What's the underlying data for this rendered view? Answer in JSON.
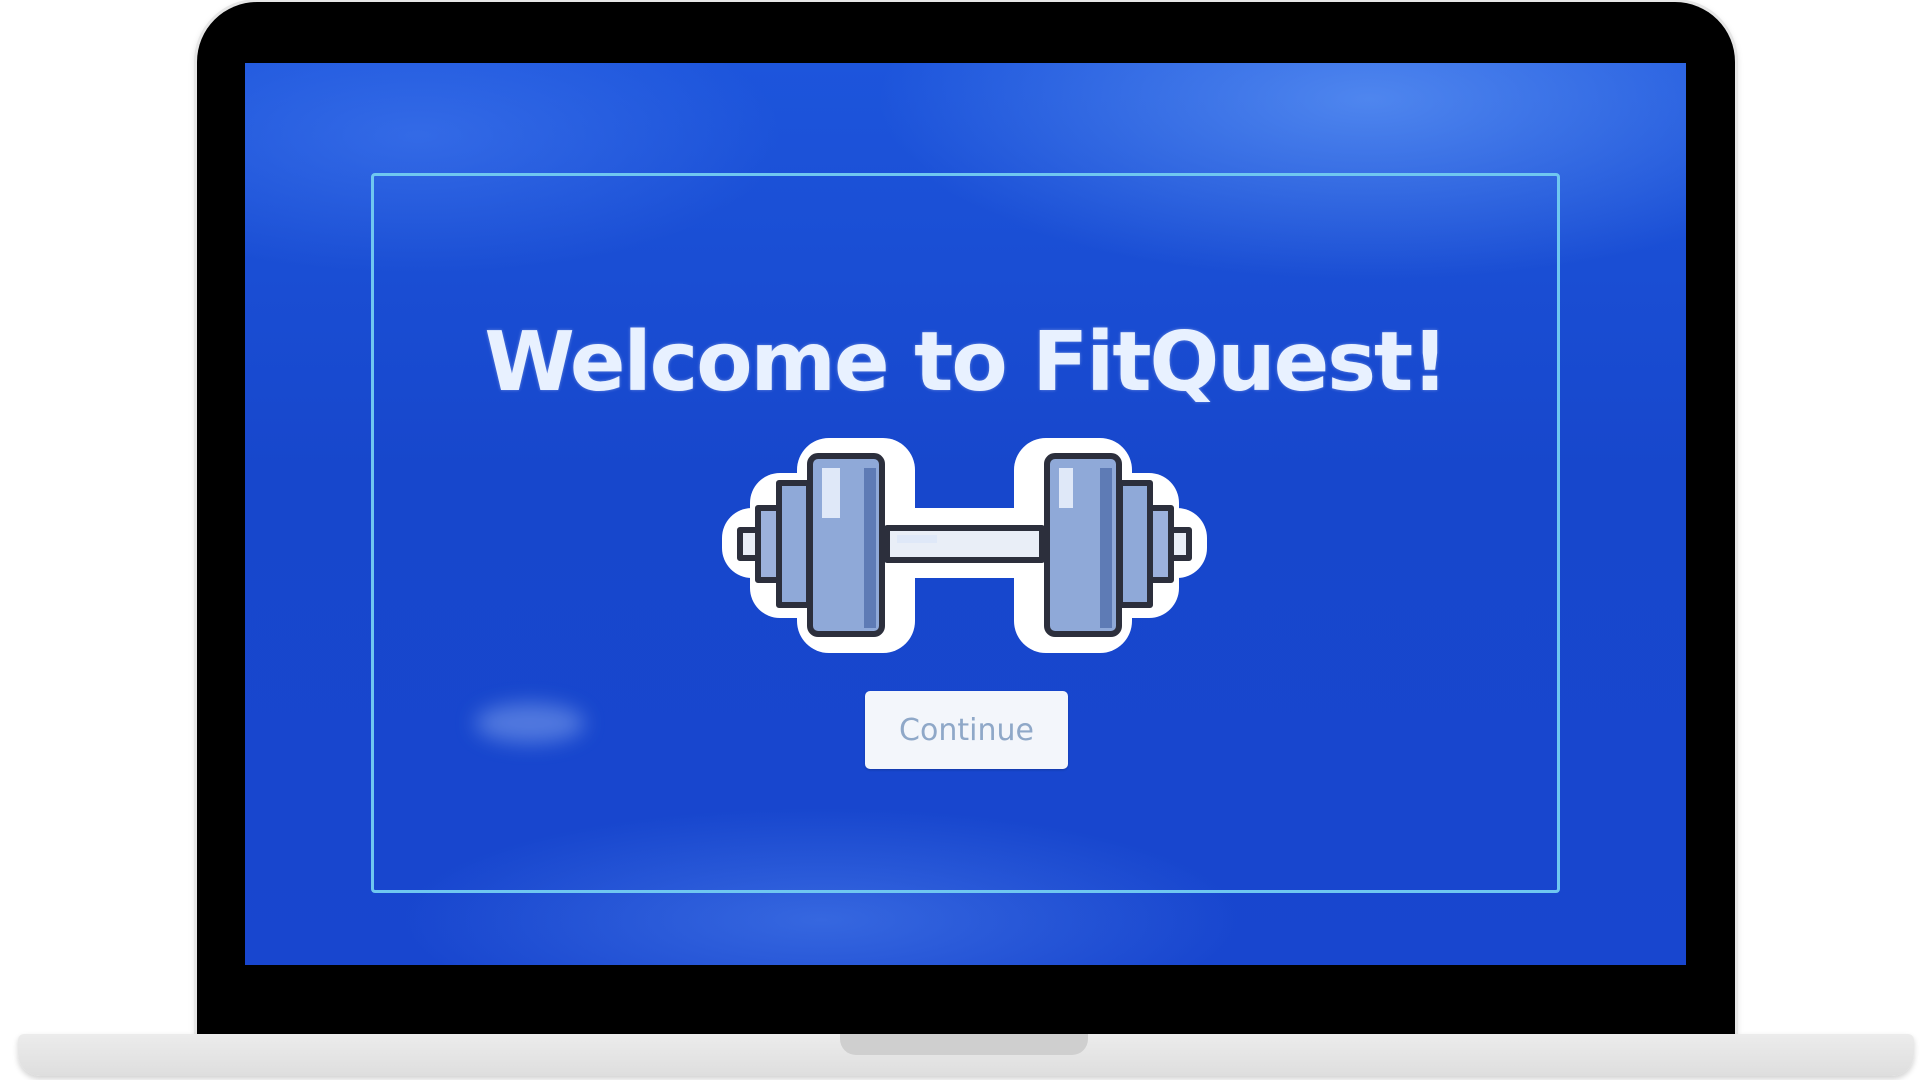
{
  "welcome": {
    "title": "Welcome to FitQuest!",
    "icon": "dumbbell-icon",
    "continue_label": "Continue"
  },
  "colors": {
    "screen_background": "#1747cc",
    "frame_border": "#6fc7f0",
    "title_text": "#e8f1ff",
    "button_background": "#f3f6fb",
    "button_text": "#8fa8c8",
    "dumbbell_plate": "#8fa9d8"
  }
}
